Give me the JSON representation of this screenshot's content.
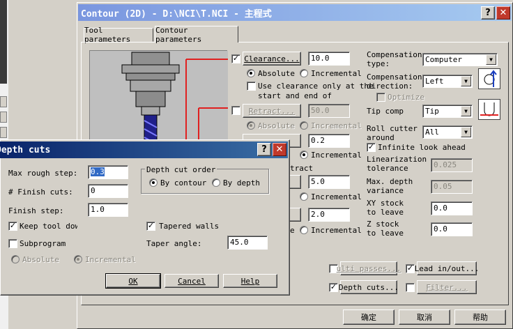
{
  "main": {
    "title": "Contour (2D) - D:\\NCI\\T.NCI - 主程式",
    "tabs": [
      {
        "label": "Tool parameters"
      },
      {
        "label": "Contour parameters"
      }
    ],
    "clearance": {
      "label": "Clearance...",
      "value": "10.0",
      "absolute": "Absolute",
      "incremental": "Incremental"
    },
    "clearance_only": "Use clearance only at the\nstart and end of",
    "retract": {
      "label": "Retract...",
      "value": "50.0",
      "absolute": "Absolute",
      "incremental": "Incremental"
    },
    "partial_values": {
      "v1": "0.2",
      "v2": "5.0",
      "v3": "2.0"
    },
    "partial_labels": {
      "incremental1": "Incremental",
      "tract": "tract",
      "incremental2": "Incremental",
      "incremental3": "Incremental"
    },
    "comp_type": {
      "label": "Compensation\ntype:",
      "value": "Computer"
    },
    "comp_dir": {
      "label": "Compensation\ndirection:",
      "value": "Left"
    },
    "optimize": "Optimize",
    "tip_comp": {
      "label": "Tip comp",
      "value": "Tip"
    },
    "roll_cutter": {
      "label": "Roll cutter\naround",
      "value": "All"
    },
    "infinite_look_ahead": "Infinite look ahead",
    "linearization": {
      "label": "Linearization\ntolerance",
      "value": "0.025"
    },
    "max_depth": {
      "label": "Max. depth\nvariance",
      "value": "0.05"
    },
    "xy_stock": {
      "label": "XY stock\nto leave",
      "value": "0.0"
    },
    "z_stock": {
      "label": "Z stock\nto leave",
      "value": "0.0"
    },
    "multi_passes": "ulti passes...",
    "lead_inout": "Lead in/out...",
    "depth_cuts_btn": "Depth cuts...",
    "filter": "Filter...",
    "ok": "确定",
    "cancel": "取消",
    "help": "帮助"
  },
  "depth_dialog": {
    "title": "Depth cuts",
    "max_rough_step": {
      "label": "Max rough step:",
      "value": "0.3"
    },
    "finish_cuts": {
      "label": "# Finish cuts:",
      "value": "0"
    },
    "finish_step": {
      "label": "Finish step:",
      "value": "1.0"
    },
    "order_group": "Depth cut order",
    "by_contour": "By contour",
    "by_depth": "By depth",
    "keep_tool_down": "Keep tool down",
    "tapered_walls": "Tapered walls",
    "subprogram": "Subprogram",
    "taper_angle": {
      "label": "Taper angle:",
      "value": "45.0"
    },
    "absolute": "Absolute",
    "incremental": "Incremental",
    "ok": "OK",
    "cancel": "Cancel",
    "help": "Help"
  },
  "colors": {
    "title_active": "#0a246a",
    "title_inactive": "#7a96df",
    "highlight": "#316ac5",
    "accent_red": "#e02020"
  },
  "icons": [
    "question-icon",
    "close-icon",
    "tool-holder-icon",
    "comp-direction-icon",
    "tip-comp-icon",
    "dropdown-arrow-icon"
  ]
}
